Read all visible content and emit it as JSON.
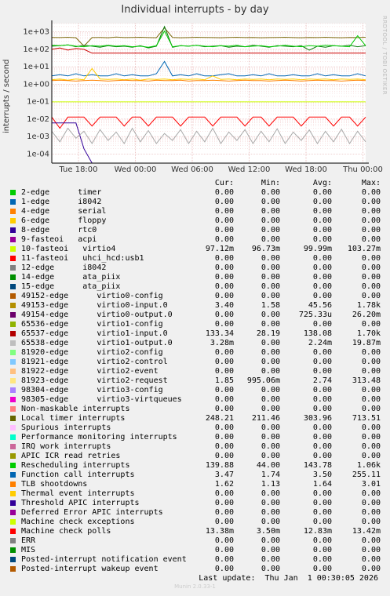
{
  "title": "Individual interrupts - by day",
  "side_label": "RRDTOOL / TOBI OETIKER",
  "chart_data": {
    "type": "line",
    "title": "Individual interrupts - by day",
    "ylabel": "interrupts / second",
    "y_scale": "log",
    "ylim": [
      3e-05,
      3000
    ],
    "y_ticks": [
      {
        "v": 1000,
        "label": "1e+03"
      },
      {
        "v": 100,
        "label": "1e+02"
      },
      {
        "v": 10,
        "label": "1e+01"
      },
      {
        "v": 1,
        "label": "1e+00"
      },
      {
        "v": 0.1,
        "label": "1e-01"
      },
      {
        "v": 0.01,
        "label": "1e-02"
      },
      {
        "v": 0.001,
        "label": "1e-03"
      },
      {
        "v": 0.0001,
        "label": "1e-04"
      }
    ],
    "x_ticks": [
      "Tue 18:00",
      "Wed 00:00",
      "Wed 06:00",
      "Wed 12:00",
      "Wed 18:00",
      "Thu 00:00"
    ],
    "grid": true,
    "series": [
      {
        "name": "Local timer interrupts",
        "color": "#7e6b0f",
        "values": [
          480,
          470,
          490,
          460,
          150,
          470,
          480,
          460,
          500,
          470,
          480,
          490,
          470,
          460,
          1700,
          480,
          460,
          470,
          490,
          480,
          470,
          460,
          480,
          490,
          470,
          480,
          460,
          470,
          480,
          490,
          470,
          460,
          480,
          470,
          490,
          470,
          460,
          480,
          470,
          490
        ]
      },
      {
        "name": "virtio1-input.0",
        "color": "#0b7b0b",
        "values": [
          150,
          160,
          180,
          140,
          170,
          150,
          130,
          160,
          140,
          150,
          130,
          160,
          120,
          150,
          2000,
          130,
          160,
          150,
          170,
          140,
          150,
          160,
          130,
          150,
          140,
          170,
          150,
          130,
          160,
          150,
          140,
          160,
          90,
          150,
          130,
          160,
          150,
          170,
          140,
          160
        ]
      },
      {
        "name": "Rescheduling interrupts",
        "color": "#00cc00",
        "values": [
          170,
          160,
          180,
          150,
          140,
          160,
          150,
          170,
          150,
          160,
          140,
          150,
          130,
          160,
          1100,
          140,
          160,
          150,
          170,
          150,
          140,
          160,
          150,
          170,
          140,
          150,
          160,
          140,
          150,
          170,
          150,
          140,
          160,
          150,
          170,
          160,
          150,
          140,
          600,
          160
        ]
      },
      {
        "name": "11-fasteoi uhci_hcd:usb1",
        "color": "#cc0000",
        "values": [
          100,
          120,
          90,
          110,
          100,
          60,
          60,
          60,
          60,
          60,
          60,
          60,
          60,
          60,
          60,
          60,
          60,
          60,
          60,
          60,
          60,
          60,
          60,
          60,
          60,
          60,
          60,
          60,
          60,
          60,
          60,
          60,
          60,
          60,
          60,
          60,
          60,
          60,
          60,
          60
        ]
      },
      {
        "name": "Function call interrupts",
        "color": "#0066b3",
        "values": [
          3,
          3.5,
          3,
          4,
          3,
          3.5,
          3,
          3,
          4,
          3,
          3.5,
          3,
          3,
          4,
          20,
          3,
          3.5,
          3,
          4,
          3,
          3,
          3.5,
          4,
          3,
          3,
          3.5,
          3,
          4,
          3,
          3,
          3.5,
          3,
          3,
          4,
          3,
          3.5,
          3,
          3,
          4,
          3
        ]
      },
      {
        "name": "virtio2-request",
        "color": "#ffcc00",
        "values": [
          1.8,
          2,
          1.7,
          2,
          1.8,
          8,
          2,
          1.9,
          2,
          1.8,
          2,
          1.7,
          2,
          1.9,
          2,
          1.8,
          2,
          1.9,
          2,
          1.8,
          3,
          1.9,
          2,
          1.8,
          2,
          1.9,
          2,
          1.8,
          2,
          1.9,
          2,
          1.8,
          2,
          1.9,
          2,
          1.8,
          2,
          1.9,
          2,
          1.8
        ]
      },
      {
        "name": "TLB shootdowns",
        "color": "#ff8000",
        "values": [
          1.6,
          1.7,
          1.6,
          1.5,
          1.6,
          1.7,
          1.6,
          1.5,
          1.6,
          1.7,
          1.6,
          1.6,
          1.5,
          1.7,
          1.6,
          1.6,
          1.7,
          1.5,
          1.6,
          1.6,
          1.7,
          1.6,
          1.5,
          1.6,
          1.7,
          1.6,
          1.6,
          1.5,
          1.6,
          1.7,
          1.6,
          1.5,
          1.6,
          1.7,
          1.6,
          1.6,
          1.5,
          1.6,
          1.7,
          1.6
        ]
      },
      {
        "name": "10-fasteoi virtio4",
        "color": "#ccff00",
        "values": [
          0.097,
          0.097,
          0.097,
          0.097,
          0.097,
          0.097,
          0.097,
          0.097,
          0.097,
          0.097,
          0.097,
          0.097,
          0.097,
          0.097,
          0.097,
          0.097,
          0.097,
          0.097,
          0.097,
          0.097,
          0.097,
          0.097,
          0.097,
          0.097,
          0.097,
          0.097,
          0.097,
          0.097,
          0.097,
          0.097,
          0.097,
          0.097,
          0.097,
          0.097,
          0.097,
          0.097,
          0.097,
          0.097,
          0.097,
          0.097
        ]
      },
      {
        "name": "Machine check polls",
        "color": "#ff0000",
        "values": [
          0.013,
          0.003,
          0.013,
          0.013,
          0.013,
          0.004,
          0.013,
          0.013,
          0.013,
          0.004,
          0.013,
          0.013,
          0.004,
          0.013,
          0.013,
          0.013,
          0.004,
          0.013,
          0.013,
          0.013,
          0.004,
          0.013,
          0.013,
          0.013,
          0.004,
          0.013,
          0.013,
          0.004,
          0.013,
          0.013,
          0.013,
          0.004,
          0.013,
          0.013,
          0.013,
          0.004,
          0.013,
          0.013,
          0.004,
          0.013
        ]
      },
      {
        "name": "virtio0-input.0",
        "color": "#330099",
        "values": [
          0.006,
          0.006,
          0.006,
          0.006,
          0.0002,
          3e-05,
          3e-05,
          3e-05,
          3e-05,
          3e-05,
          3e-05,
          3e-05,
          3e-05,
          3e-05,
          3e-05,
          3e-05,
          3e-05,
          3e-05,
          3e-05,
          3e-05,
          3e-05,
          3e-05,
          3e-05,
          3e-05,
          3e-05,
          3e-05,
          3e-05,
          3e-05,
          3e-05,
          3e-05,
          3e-05,
          3e-05,
          3e-05,
          3e-05,
          3e-05,
          3e-05,
          3e-05,
          3e-05,
          3e-05,
          3e-05
        ]
      },
      {
        "name": "virtio1-output.0",
        "color": "#aaaaaa",
        "values": [
          0.002,
          0.0005,
          0.003,
          0.0008,
          0.002,
          0.0004,
          0.0025,
          0.0006,
          0.0018,
          0.0004,
          0.003,
          0.0005,
          0.0022,
          0.0004,
          0.0015,
          0.0006,
          0.0025,
          0.0004,
          0.002,
          0.0005,
          0.003,
          0.0004,
          0.0018,
          0.0006,
          0.0025,
          0.0004,
          0.002,
          0.0005,
          0.0028,
          0.0004,
          0.0018,
          0.0006,
          0.0024,
          0.0004,
          0.002,
          0.0005,
          0.0026,
          0.0004,
          0.002,
          0.0005
        ]
      }
    ]
  },
  "legend": {
    "headers": [
      "Cur:",
      "Min:",
      "Avg:",
      "Max:"
    ],
    "rows": [
      {
        "color": "#00cc00",
        "label": "2-edge      timer",
        "cur": "0.00",
        "min": "0.00",
        "avg": "0.00",
        "max": "0.00"
      },
      {
        "color": "#0066b3",
        "label": "1-edge      i8042",
        "cur": "0.00",
        "min": "0.00",
        "avg": "0.00",
        "max": "0.00"
      },
      {
        "color": "#ff8000",
        "label": "4-edge      serial",
        "cur": "0.00",
        "min": "0.00",
        "avg": "0.00",
        "max": "0.00"
      },
      {
        "color": "#ffcc00",
        "label": "6-edge      floppy",
        "cur": "0.00",
        "min": "0.00",
        "avg": "0.00",
        "max": "0.00"
      },
      {
        "color": "#330099",
        "label": "8-edge      rtc0",
        "cur": "0.00",
        "min": "0.00",
        "avg": "0.00",
        "max": "0.00"
      },
      {
        "color": "#990099",
        "label": "9-fasteoi   acpi",
        "cur": "0.00",
        "min": "0.00",
        "avg": "0.00",
        "max": "0.00"
      },
      {
        "color": "#ccff00",
        "label": "10-fasteoi   virtio4",
        "cur": "97.12m",
        "min": "96.73m",
        "avg": "99.99m",
        "max": "103.27m"
      },
      {
        "color": "#ff0000",
        "label": "11-fasteoi   uhci_hcd:usb1",
        "cur": "0.00",
        "min": "0.00",
        "avg": "0.00",
        "max": "0.00"
      },
      {
        "color": "#808080",
        "label": "12-edge      i8042",
        "cur": "0.00",
        "min": "0.00",
        "avg": "0.00",
        "max": "0.00"
      },
      {
        "color": "#008f00",
        "label": "14-edge      ata_piix",
        "cur": "0.00",
        "min": "0.00",
        "avg": "0.00",
        "max": "0.00"
      },
      {
        "color": "#00487d",
        "label": "15-edge      ata_piix",
        "cur": "0.00",
        "min": "0.00",
        "avg": "0.00",
        "max": "0.00"
      },
      {
        "color": "#b35a00",
        "label": "49152-edge      virtio0-config",
        "cur": "0.00",
        "min": "0.00",
        "avg": "0.00",
        "max": "0.00"
      },
      {
        "color": "#b38f00",
        "label": "49153-edge      virtio0-input.0",
        "cur": "3.40",
        "min": "1.58",
        "avg": "45.56",
        "max": "1.78k"
      },
      {
        "color": "#6b006b",
        "label": "49154-edge      virtio0-output.0",
        "cur": "0.00",
        "min": "0.00",
        "avg": "725.33u",
        "max": "26.20m"
      },
      {
        "color": "#8fb300",
        "label": "65536-edge      virtio1-config",
        "cur": "0.00",
        "min": "0.00",
        "avg": "0.00",
        "max": "0.00"
      },
      {
        "color": "#b30000",
        "label": "65537-edge      virtio1-input.0",
        "cur": "133.34",
        "min": "28.19",
        "avg": "138.08",
        "max": "1.70k"
      },
      {
        "color": "#bebebe",
        "label": "65538-edge      virtio1-output.0",
        "cur": "3.28m",
        "min": "0.00",
        "avg": "2.24m",
        "max": "19.87m"
      },
      {
        "color": "#80ff80",
        "label": "81920-edge      virtio2-config",
        "cur": "0.00",
        "min": "0.00",
        "avg": "0.00",
        "max": "0.00"
      },
      {
        "color": "#80c9ff",
        "label": "81921-edge      virtio2-control",
        "cur": "0.00",
        "min": "0.00",
        "avg": "0.00",
        "max": "0.00"
      },
      {
        "color": "#ffc080",
        "label": "81922-edge      virtio2-event",
        "cur": "0.00",
        "min": "0.00",
        "avg": "0.00",
        "max": "0.00"
      },
      {
        "color": "#ffe680",
        "label": "81923-edge      virtio2-request",
        "cur": "1.85",
        "min": "995.06m",
        "avg": "2.74",
        "max": "313.48"
      },
      {
        "color": "#aa80ff",
        "label": "98304-edge      virtio3-config",
        "cur": "0.00",
        "min": "0.00",
        "avg": "0.00",
        "max": "0.00"
      },
      {
        "color": "#ee00cc",
        "label": "98305-edge      virtio3-virtqueues",
        "cur": "0.00",
        "min": "0.00",
        "avg": "0.00",
        "max": "0.00"
      },
      {
        "color": "#ff8080",
        "label": "Non-maskable interrupts",
        "cur": "0.00",
        "min": "0.00",
        "avg": "0.00",
        "max": "0.00"
      },
      {
        "color": "#666600",
        "label": "Local timer interrupts",
        "cur": "248.21",
        "min": "211.46",
        "avg": "303.96",
        "max": "713.51"
      },
      {
        "color": "#ffbfff",
        "label": "Spurious interrupts",
        "cur": "0.00",
        "min": "0.00",
        "avg": "0.00",
        "max": "0.00"
      },
      {
        "color": "#00ffcc",
        "label": "Performance monitoring interrupts",
        "cur": "0.00",
        "min": "0.00",
        "avg": "0.00",
        "max": "0.00"
      },
      {
        "color": "#cc6699",
        "label": "IRQ work interrupts",
        "cur": "0.00",
        "min": "0.00",
        "avg": "0.00",
        "max": "0.00"
      },
      {
        "color": "#999900",
        "label": "APIC ICR read retries",
        "cur": "0.00",
        "min": "0.00",
        "avg": "0.00",
        "max": "0.00"
      },
      {
        "color": "#00cc00",
        "label": "Rescheduling interrupts",
        "cur": "139.88",
        "min": "44.00",
        "avg": "143.78",
        "max": "1.06k"
      },
      {
        "color": "#0066b3",
        "label": "Function call interrupts",
        "cur": "3.47",
        "min": "1.74",
        "avg": "3.50",
        "max": "255.11"
      },
      {
        "color": "#ff8000",
        "label": "TLB shootdowns",
        "cur": "1.62",
        "min": "1.13",
        "avg": "1.64",
        "max": "3.01"
      },
      {
        "color": "#ffcc00",
        "label": "Thermal event interrupts",
        "cur": "0.00",
        "min": "0.00",
        "avg": "0.00",
        "max": "0.00"
      },
      {
        "color": "#330099",
        "label": "Threshold APIC interrupts",
        "cur": "0.00",
        "min": "0.00",
        "avg": "0.00",
        "max": "0.00"
      },
      {
        "color": "#990099",
        "label": "Deferred Error APIC interrupts",
        "cur": "0.00",
        "min": "0.00",
        "avg": "0.00",
        "max": "0.00"
      },
      {
        "color": "#ccff00",
        "label": "Machine check exceptions",
        "cur": "0.00",
        "min": "0.00",
        "avg": "0.00",
        "max": "0.00"
      },
      {
        "color": "#ff0000",
        "label": "Machine check polls",
        "cur": "13.38m",
        "min": "3.50m",
        "avg": "12.83m",
        "max": "13.42m"
      },
      {
        "color": "#808080",
        "label": "ERR",
        "cur": "0.00",
        "min": "0.00",
        "avg": "0.00",
        "max": "0.00"
      },
      {
        "color": "#008f00",
        "label": "MIS",
        "cur": "0.00",
        "min": "0.00",
        "avg": "0.00",
        "max": "0.00"
      },
      {
        "color": "#00487d",
        "label": "Posted-interrupt notification event",
        "cur": "0.00",
        "min": "0.00",
        "avg": "0.00",
        "max": "0.00"
      },
      {
        "color": "#b35a00",
        "label": "Posted-interrupt wakeup event",
        "cur": "0.00",
        "min": "0.00",
        "avg": "0.00",
        "max": "0.00"
      }
    ]
  },
  "footer": {
    "last_update": "Last update:  Thu Jan  1 00:30:05 2026",
    "version": "Munin 2.0.33-1"
  }
}
